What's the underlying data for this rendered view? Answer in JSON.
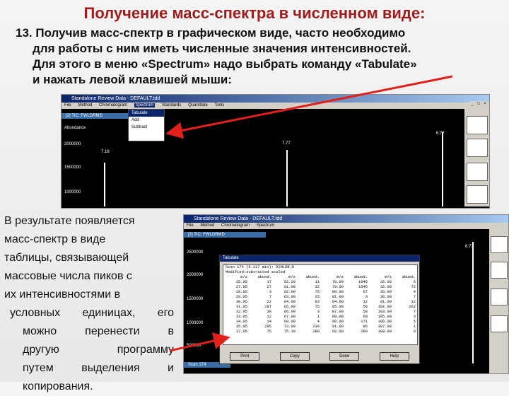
{
  "slide": {
    "title": "Получение масс-спектра в численном виде:",
    "intro_lines": [
      "13. Получив масс-спектр в графическом виде, часто необходимо",
      "для работы с ним иметь численные значения интенсивностей.",
      "Для этого в меню «Spectrum» надо выбрать команду «Tabulate»",
      "и нажать левой клавишей мыши:"
    ],
    "side_lines": [
      "В результате появляется",
      "масс-спектр в виде",
      "таблицы, связывающей",
      "массовые числа пиков с",
      "их интенсивностями в",
      "условных единицах, его",
      "можно перенести в",
      "другую программу",
      "путем выделения и",
      "копирования."
    ]
  },
  "app1": {
    "title": "Standalone Review Data - DEFAULT.tdd",
    "menu": [
      "File",
      "Method",
      "Chromatogram",
      "Spectrum",
      "Standards",
      "Quantitate",
      "Tools"
    ],
    "spectrum_menu": [
      "Tabulate",
      "Add",
      "Subtract"
    ],
    "subtitle": "[2] TIC: FWLDRMD",
    "y_labels": [
      "Abundance",
      "2000000",
      "1500000",
      "1000000"
    ],
    "peak_labels": [
      "7.18",
      "7.77",
      "6.77"
    ]
  },
  "app2": {
    "title": "Standalone Review Data - DEFAULT.tdd",
    "subtitle": "[2] TIC: FWLDRMD",
    "y_labels": [
      "2500000",
      "2000000",
      "1500000",
      "1000000",
      "500000"
    ],
    "peak_labels": [
      "6.77"
    ],
    "bottom_subtitle": "Scan 174"
  },
  "tabulate": {
    "title": "Tabulate",
    "header": "Scan 174 (6.117 min): DIMLDR.D",
    "subheader": "Modified:subtracted scaled",
    "columns": [
      "m/z",
      "abund.",
      "m/z",
      "abund.",
      "m/z",
      "abund.",
      "m/z",
      "abund."
    ],
    "rows": [
      [
        "25.05",
        "17",
        "52.20",
        "11",
        "78.00",
        "1046",
        "32.00",
        "6"
      ],
      [
        "27.05",
        "27",
        "61.00",
        "32",
        "79.00",
        "1546",
        "32.00",
        "72"
      ],
      [
        "28.05",
        "3",
        "62.00",
        "75",
        "80.00",
        "67",
        "35.00",
        "4"
      ],
      [
        "29.05",
        "7",
        "63.00",
        "25",
        "81.00",
        "3",
        "36.00",
        "7"
      ],
      [
        "30.05",
        "22",
        "64.00",
        "83",
        "84.00",
        "12",
        "91.00",
        "12"
      ],
      [
        "31.05",
        "197",
        "65.00",
        "75",
        "85.00",
        "50",
        "102.00",
        "262"
      ],
      [
        "32.05",
        "38",
        "66.00",
        "3",
        "87.00",
        "50",
        "103.00",
        "7"
      ],
      [
        "33.05",
        "12",
        "67.00",
        "1",
        "89.00",
        "60",
        "105.00",
        "3"
      ],
      [
        "34.05",
        "14",
        "68.00",
        "4",
        "90.00",
        "171",
        "106.00",
        "5"
      ],
      [
        "35.05",
        "295",
        "73.00",
        "230",
        "91.00",
        "86",
        "107.00",
        "1"
      ],
      [
        "37.05",
        "75",
        "75.10",
        "280",
        "92.00",
        "260",
        "108.00",
        "6"
      ]
    ],
    "buttons": [
      "Print",
      "Copy",
      "Done",
      "Help"
    ]
  },
  "colors": {
    "title": "#9e1c1c",
    "arrow": "#e0201a",
    "plot_bg": "#000000"
  }
}
